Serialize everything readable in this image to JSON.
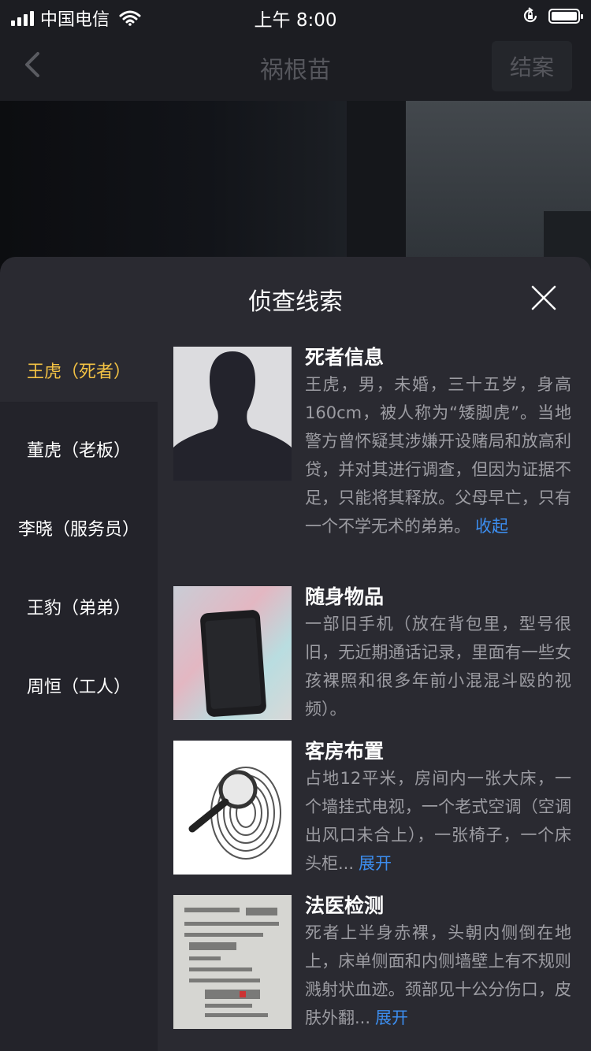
{
  "status_bar": {
    "carrier": "中国电信",
    "time": "上午 8:00"
  },
  "nav": {
    "title": "祸根苗",
    "action_label": "结案"
  },
  "sheet": {
    "title": "侦查线索",
    "suspects": [
      {
        "label": "王虎（死者）",
        "active": true
      },
      {
        "label": "董虎（老板）",
        "active": false
      },
      {
        "label": "李晓（服务员）",
        "active": false
      },
      {
        "label": "王豹（弟弟）",
        "active": false
      },
      {
        "label": "周恒（工人）",
        "active": false
      }
    ],
    "clues": [
      {
        "title": "死者信息",
        "text": "王虎，男，未婚，三十五岁，身高160cm，被人称为“矮脚虎”。当地警方曾怀疑其涉嫌开设赌局和放高利贷，并对其进行调查，但因为证据不足，只能将其释放。父母早亡，只有一个不学无术的弟弟。",
        "link": "收起"
      },
      {
        "title": "随身物品",
        "text": "一部旧手机（放在背包里，型号很旧，无近期通话记录，里面有一些女孩裸照和很多年前小混混斗殴的视频）。",
        "link": ""
      },
      {
        "title": "客房布置",
        "text": "占地12平米，房间内一张大床，一个墙挂式电视，一个老式空调（空调出风口未合上），一张椅子，一个床头柜...",
        "link": "展开"
      },
      {
        "title": "法医检测",
        "text": "死者上半身赤裸，头朝内侧倒在地上，床单侧面和内侧墙壁上有不规则溅射状血迹。颈部见十公分伤口，皮肤外翻...",
        "link": "展开"
      }
    ]
  },
  "colors": {
    "active": "#f3c244",
    "link": "#3c8ef0",
    "muted": "#9c9ca2"
  },
  "icons": [
    "back-chevron-icon",
    "close-icon",
    "signal-icon",
    "wifi-icon",
    "orientation-lock-icon",
    "battery-icon"
  ]
}
